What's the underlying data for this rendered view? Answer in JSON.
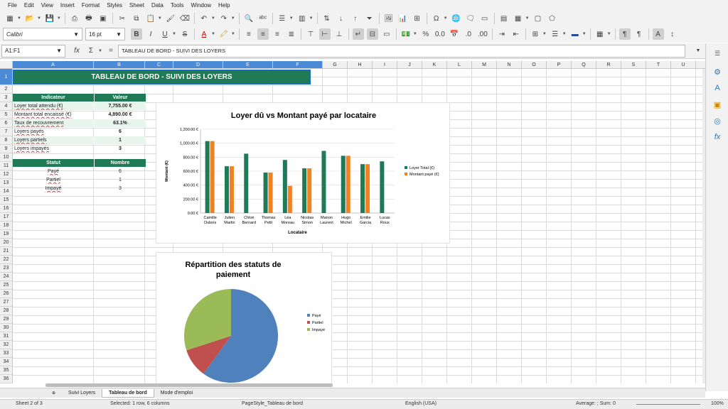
{
  "menu": [
    "File",
    "Edit",
    "View",
    "Insert",
    "Format",
    "Styles",
    "Sheet",
    "Data",
    "Tools",
    "Window",
    "Help"
  ],
  "font_name": "Calibri",
  "font_size": "16 pt",
  "name_box": "A1:F1",
  "formula_content": "TABLEAU DE BORD - SUIVI DES LOYERS",
  "columns": [
    "A",
    "B",
    "C",
    "D",
    "E",
    "F",
    "G",
    "H",
    "I",
    "J",
    "K",
    "L",
    "M",
    "N",
    "O",
    "P",
    "Q",
    "R",
    "S",
    "T",
    "U",
    "V"
  ],
  "rows": [
    "1",
    "2",
    "3",
    "4",
    "5",
    "6",
    "7",
    "8",
    "9",
    "10",
    "11",
    "12",
    "13",
    "14",
    "15",
    "16",
    "17",
    "18",
    "19",
    "20",
    "21",
    "22",
    "23",
    "24",
    "25",
    "26",
    "27",
    "28",
    "29",
    "30",
    "31",
    "32",
    "33",
    "34",
    "35",
    "36",
    "37"
  ],
  "sheet": {
    "title": "TABLEAU DE BORD - SUIVI DES LOYERS",
    "indicator_header": "Indicateur",
    "value_header": "Valeur",
    "indicators": [
      {
        "label": "Loyer total attendu (€)",
        "value": "7,755.00 €"
      },
      {
        "label": "Montant total encaissé (€)",
        "value": "4,890.00 €"
      },
      {
        "label": "Taux de recouvrement",
        "value": "63.1%"
      },
      {
        "label": "Loyers payés",
        "value": "6"
      },
      {
        "label": "Loyers partiels",
        "value": "1"
      },
      {
        "label": "Loyers impayés",
        "value": "3"
      }
    ],
    "status_header": "Statut",
    "count_header": "Nombre",
    "statuses": [
      {
        "label": "Payé",
        "count": "6"
      },
      {
        "label": "Partiel",
        "count": "1"
      },
      {
        "label": "Impayé",
        "count": "3"
      }
    ]
  },
  "chart_data": [
    {
      "type": "bar",
      "title": "Loyer dû vs Montant payé par locataire",
      "xlabel": "Locataire",
      "ylabel": "Montant (€)",
      "ylim": [
        0,
        1200
      ],
      "yticks": [
        "0.00 €",
        "200.00 €",
        "400.00 €",
        "600.00 €",
        "800.00 €",
        "1,000.00 €",
        "1,200.00 €"
      ],
      "categories": [
        [
          "Camille",
          "Dubois"
        ],
        [
          "Julien",
          "Martin"
        ],
        [
          "Chloé",
          "Bernard"
        ],
        [
          "Thomas",
          "Petit"
        ],
        [
          "Léa",
          "Moreau"
        ],
        [
          "Nicolas",
          "Simon"
        ],
        [
          "Manon",
          "Laurent"
        ],
        [
          "Hugo",
          "Michel"
        ],
        [
          "Emilie",
          "Garcia"
        ],
        [
          "Lucas",
          "Roux"
        ]
      ],
      "series": [
        {
          "name": "Loyer Total (€)",
          "color": "#1e7a57",
          "values": [
            1030,
            670,
            850,
            580,
            760,
            640,
            890,
            820,
            700,
            740
          ]
        },
        {
          "name": "Montant payé (€)",
          "color": "#f08224",
          "values": [
            1030,
            670,
            0,
            580,
            390,
            640,
            0,
            820,
            700,
            0
          ]
        }
      ],
      "legend": "right"
    },
    {
      "type": "pie",
      "title": "Répartition des statuts de paiement",
      "labels": [
        "Payé",
        "Partiel",
        "Impayé"
      ],
      "values": [
        6,
        1,
        3
      ],
      "colors": [
        "#4f81bd",
        "#c0504d",
        "#9bbb59"
      ],
      "legend": "right"
    }
  ],
  "tabs": [
    "Suivi Loyers",
    "Tableau de bord",
    "Mode d'emploi"
  ],
  "status": {
    "sheet": "Sheet 2 of 3",
    "selection": "Selected: 1 row, 6 columns",
    "pagestyle": "PageStyle_Tableau de bord",
    "language": "English (USA)",
    "sum": "Average: ; Sum: 0",
    "zoom": "100%"
  }
}
